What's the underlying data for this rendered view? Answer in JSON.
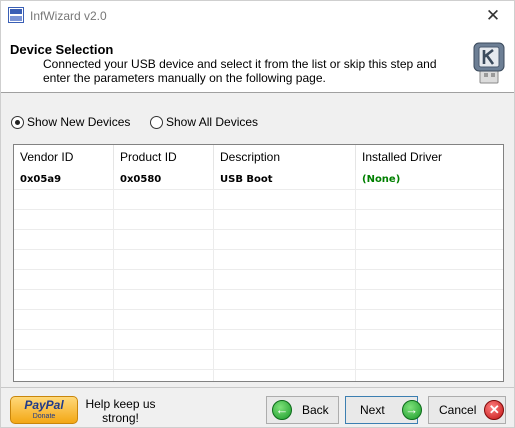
{
  "window": {
    "title": "InfWizard v2.0"
  },
  "header": {
    "title": "Device Selection",
    "description": "Connected your USB device and select it from the list or skip this step and enter the parameters manually on the following page."
  },
  "device_filter": {
    "options": [
      {
        "label": "Show New Devices",
        "checked": true
      },
      {
        "label": "Show All Devices",
        "checked": false
      }
    ]
  },
  "device_table": {
    "columns": [
      "Vendor ID",
      "Product ID",
      "Description",
      "Installed Driver"
    ],
    "rows": [
      [
        "0x05a9",
        "0x0580",
        "USB Boot",
        "(None)"
      ]
    ]
  },
  "footer": {
    "paypal": {
      "brand": "PayPal",
      "action": "Donate"
    },
    "help_text": "Help keep us strong!",
    "back_label": "Back",
    "next_label": "Next",
    "cancel_label": "Cancel"
  },
  "colors": {
    "installed_driver_none": "#008000",
    "back_next_icon": "#1a9a2a",
    "cancel_icon": "#c21313"
  },
  "icons": {
    "app": "infwizard-app-icon",
    "header": "usb-drive-icon",
    "back": "arrow-left-icon",
    "next": "arrow-right-icon",
    "cancel": "close-icon"
  }
}
